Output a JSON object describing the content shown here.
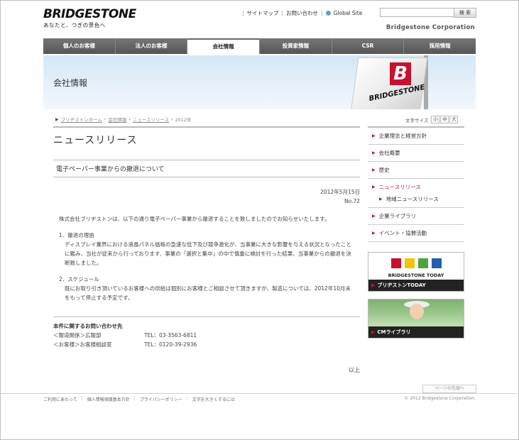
{
  "header": {
    "logo_text": "BRIDGESTONE",
    "tagline": "あなたと、つぎの景色へ",
    "links": [
      "サイトマップ",
      "お問い合わせ",
      "Global Site"
    ],
    "search_button": "検 索",
    "search_value": "",
    "corporation": "Bridgestone Corporation"
  },
  "nav": {
    "items": [
      "個人のお客様",
      "法人のお客様",
      "会社情報",
      "投資家情報",
      "CSR",
      "採用情報"
    ],
    "active_index": 2
  },
  "banner": {
    "title": "会社情報",
    "sign_letter": "B",
    "sign_text": "BRIDGESTONE"
  },
  "breadcrumb": [
    "ブリヂストンホーム",
    "会社情報",
    "ニュースリリース",
    "2012年"
  ],
  "font_size": {
    "label": "文字サイズ",
    "options": [
      "小",
      "中",
      "大"
    ]
  },
  "main": {
    "heading": "ニュースリリース",
    "article_title": "電子ペーパー事業からの撤退について",
    "date": "2012年5月15日",
    "number": "No.72",
    "intro": "株式会社ブリヂストンは、以下の通り電子ペーパー事業から撤退することを致しましたのでお知らせいたします。",
    "items": [
      {
        "head": "1．撤退の理由",
        "body": "ディスプレイ業界における液晶パネル価格の急速な低下及び競争激化が、当事業に大きな影響を与える状況となったことに鑑み、当社が従来から行っております、事業の「選択と集中」の中で慎重に検討を行った結果、当事業からの撤退を決断致しました。"
      },
      {
        "head": "2．スケジュール",
        "body": "既にお取り引き頂いているお客様への供給は個別にお客様とご相談させて頂きますが、製造については、2012年10月末をもって停止する予定です。"
      }
    ],
    "contact": {
      "title": "本件に関するお問い合わせ先",
      "rows": [
        {
          "label": "＜報道関係＞広報部",
          "tel": "TEL：03-3563-6811"
        },
        {
          "label": "＜お客様＞お客様相談室",
          "tel": "TEL：0120-39-2936"
        }
      ]
    },
    "end_text": "以上"
  },
  "side": {
    "items": [
      "企業理念と経営方針",
      "会社概要",
      "歴史",
      "ニュースリリース",
      "企業ライブラリ",
      "イベント・協賛活動"
    ],
    "active": "ニュースリリース",
    "sub_item": "地域ニュースリリース",
    "promo1_brand": "BRIDGESTONE TODAY",
    "promo1_label": "ブリヂストンTODAY",
    "promo2_label": "CMライブラリ"
  },
  "footer": {
    "page_top": "ページの先頭へ",
    "links": [
      "ご利用にあたって",
      "個人情報保護基本方針",
      "プライバシーポリシー",
      "文字を大きくするには"
    ],
    "copyright": "© 2012 Bridgestone Corporation."
  },
  "colors": {
    "brand_red": "#c8102e",
    "nav_gray": "#666666"
  }
}
